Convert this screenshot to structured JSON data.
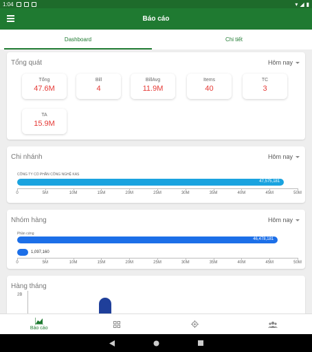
{
  "status_bar": {
    "time": "1:04"
  },
  "app_bar": {
    "title": "Báo cáo"
  },
  "tabs": [
    {
      "label": "Dashboard"
    },
    {
      "label": "Chi tiết"
    }
  ],
  "overview": {
    "title": "Tổng quát",
    "filter": "Hôm nay",
    "tiles": [
      {
        "label": "Tổng",
        "value": "47.6M"
      },
      {
        "label": "Bill",
        "value": "4"
      },
      {
        "label": "BillAvg",
        "value": "11.9M"
      },
      {
        "label": "Items",
        "value": "40"
      },
      {
        "label": "TC",
        "value": "3"
      },
      {
        "label": "TA",
        "value": "15.9M"
      }
    ]
  },
  "branch": {
    "title": "Chi nhánh",
    "filter": "Hôm nay",
    "bar_label": "CÔNG TY CỔ PHẦN CÔNG NGHỆ KAS",
    "bar_value": "47,575,181",
    "ticks": [
      "0",
      "5M",
      "10M",
      "15M",
      "20M",
      "25M",
      "30M",
      "35M",
      "40M",
      "45M",
      "50M"
    ]
  },
  "group": {
    "title": "Nhóm hàng",
    "filter": "Hôm nay",
    "bar1_label": "Phần cứng",
    "bar1_value": "46,478,181",
    "bar2_value": "1,097,160",
    "ticks": [
      "0",
      "5M",
      "10M",
      "15M",
      "20M",
      "25M",
      "30M",
      "35M",
      "40M",
      "45M",
      "50M"
    ]
  },
  "monthly": {
    "title": "Hàng tháng",
    "y_label": "2B"
  },
  "bottom_nav": [
    {
      "label": "Báo cáo"
    }
  ],
  "colors": {
    "primary": "#1f7a31",
    "branch_bar": "#1aa3df",
    "group_bar": "#1c6fe8",
    "value_red": "#e53935"
  },
  "chart_data": [
    {
      "type": "bar",
      "categories": [
        "CÔNG TY CỔ PHẦN CÔNG NGHỆ KAS"
      ],
      "values": [
        47575181
      ],
      "xlim": [
        0,
        50000000
      ]
    },
    {
      "type": "bar",
      "categories": [
        "Phần cứng",
        ""
      ],
      "values": [
        46478181,
        1097160
      ],
      "xlim": [
        0,
        50000000
      ]
    }
  ]
}
